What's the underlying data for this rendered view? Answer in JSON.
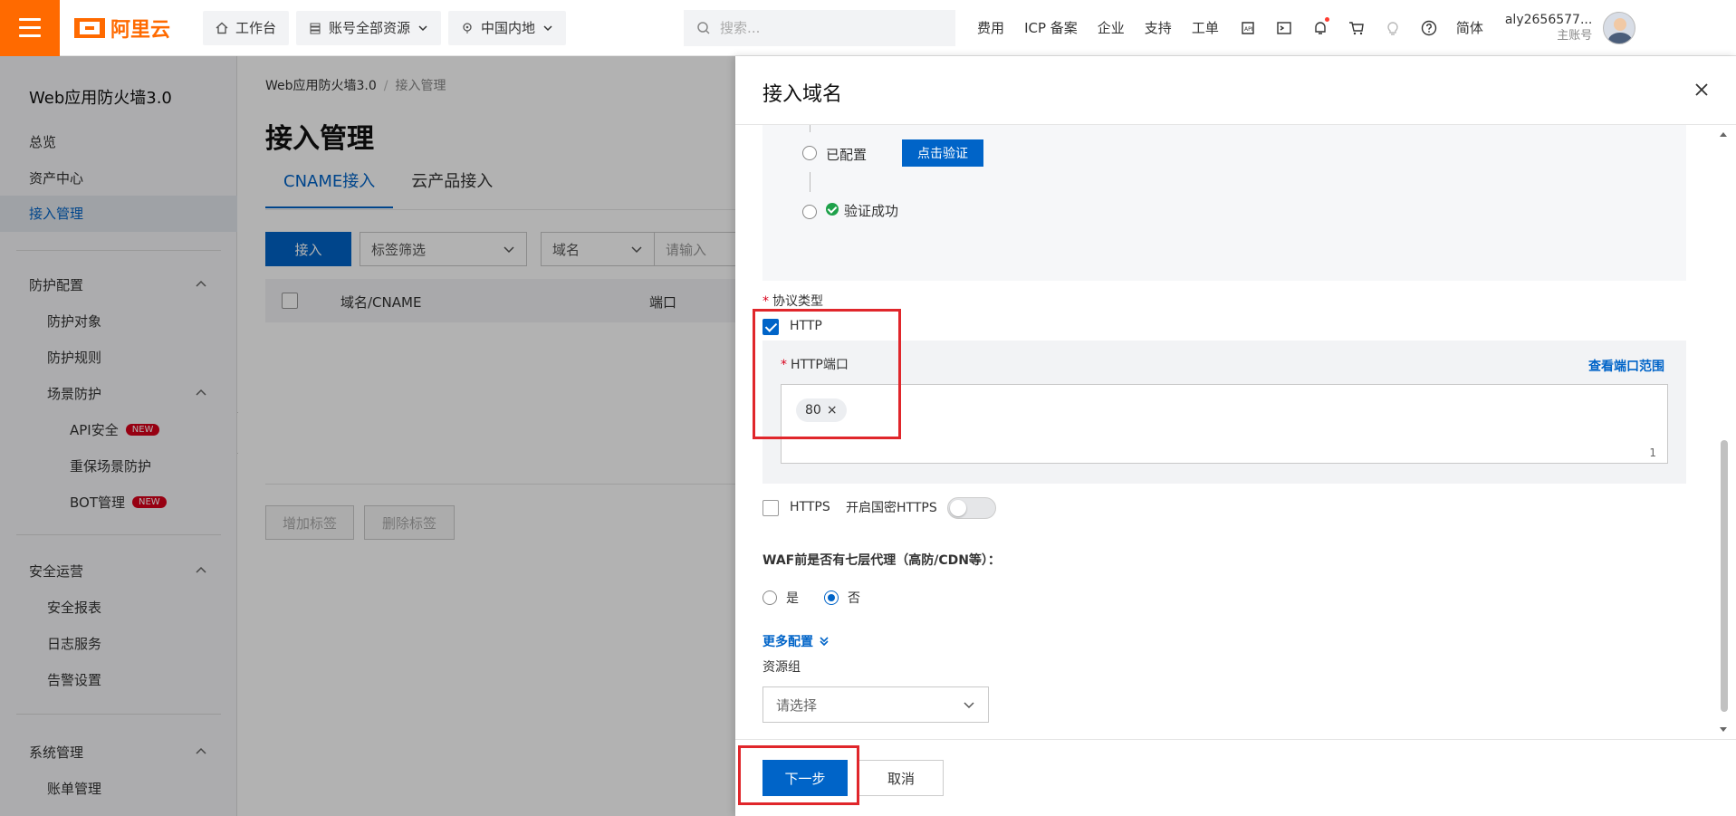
{
  "topbar": {
    "logo_text": "阿里云",
    "workbench": "工作台",
    "resources": "账号全部资源",
    "region": "中国内地",
    "search_placeholder": "搜索...",
    "links": [
      "费用",
      "ICP 备案",
      "企业",
      "支持",
      "工单"
    ],
    "lang": "简体",
    "account_name": "aly2656577...",
    "account_type": "主账号"
  },
  "sidebar": {
    "title": "Web应用防火墙3.0",
    "overview": "总览",
    "asset_center": "资产中心",
    "access_mgmt": "接入管理",
    "protect_config": "防护配置",
    "protect_object": "防护对象",
    "protect_rules": "防护规则",
    "scene_protect": "场景防护",
    "api_security": "API安全",
    "key_scene": "重保场景防护",
    "bot_mgmt": "BOT管理",
    "new_badge": "NEW",
    "sec_ops": "安全运营",
    "sec_report": "安全报表",
    "log_service": "日志服务",
    "alert_settings": "告警设置",
    "sys_mgmt": "系统管理",
    "billing": "账单管理"
  },
  "main": {
    "breadcrumb_root": "Web应用防火墙3.0",
    "breadcrumb_current": "接入管理",
    "title": "接入管理",
    "tabs": [
      "CNAME接入",
      "云产品接入"
    ],
    "add_button": "接入",
    "tag_filter": "标签筛选",
    "domain_select": "域名",
    "search_placeholder": "请输入",
    "columns": [
      "域名/CNAME",
      "端口"
    ],
    "add_tag": "增加标签",
    "delete_tag": "删除标签"
  },
  "drawer": {
    "title": "接入域名",
    "configured": "已配置",
    "verify_button": "点击验证",
    "verify_success": "验证成功",
    "protocol_label": "协议类型",
    "http": "HTTP",
    "http_port_label": "HTTP端口",
    "view_port_range": "查看端口范围",
    "port_tag": "80",
    "port_count": "1",
    "https": "HTTPS",
    "sm_https": "开启国密HTTPS",
    "proxy_question": "WAF前是否有七层代理（高防/CDN等）：",
    "yes": "是",
    "no": "否",
    "more_config": "更多配置",
    "resource_group": "资源组",
    "select_placeholder": "请选择",
    "next": "下一步",
    "cancel": "取消"
  },
  "colors": {
    "accent": "#0064c8",
    "brand": "#ff6a00",
    "highlight": "#e0262b"
  }
}
